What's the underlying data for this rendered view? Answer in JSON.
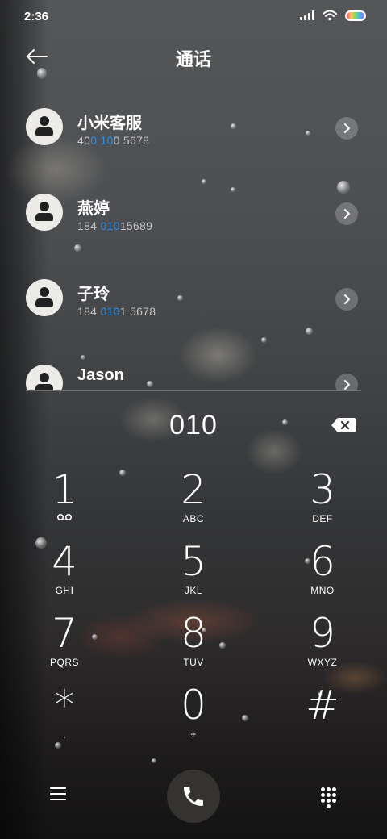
{
  "status_bar": {
    "time": "2:36",
    "icons": [
      "signal-icon",
      "wifi-icon",
      "battery-icon"
    ]
  },
  "header": {
    "back_icon": "arrow-left-icon",
    "title": "通话"
  },
  "contacts": [
    {
      "name": "小米客服",
      "number_before": "40",
      "number_match": "0 10",
      "number_after": "0 5678"
    },
    {
      "name": "燕婷",
      "number_before": "184 ",
      "number_match": "010",
      "number_after": "15689"
    },
    {
      "name": "子玲",
      "number_before": "184 ",
      "number_match": "010",
      "number_after": "1 5678"
    },
    {
      "name": "Jason",
      "number_before": "",
      "number_match": "",
      "number_after": ""
    }
  ],
  "dialed_number": "010",
  "keypad": [
    {
      "digit": "1",
      "letters": ""
    },
    {
      "digit": "2",
      "letters": "ABC"
    },
    {
      "digit": "3",
      "letters": "DEF"
    },
    {
      "digit": "4",
      "letters": "GHI"
    },
    {
      "digit": "5",
      "letters": "JKL"
    },
    {
      "digit": "6",
      "letters": "MNO"
    },
    {
      "digit": "7",
      "letters": "PQRS"
    },
    {
      "digit": "8",
      "letters": "TUV"
    },
    {
      "digit": "9",
      "letters": "WXYZ"
    },
    {
      "digit": "*",
      "letters": ","
    },
    {
      "digit": "0",
      "letters": "+"
    },
    {
      "digit": "#",
      "letters": ""
    }
  ],
  "colors": {
    "match_highlight": "#2f8de0",
    "call_button": "#343330"
  },
  "bottom_bar": {
    "icons": [
      "menu-icon",
      "phone-icon",
      "dialpad-icon"
    ]
  }
}
